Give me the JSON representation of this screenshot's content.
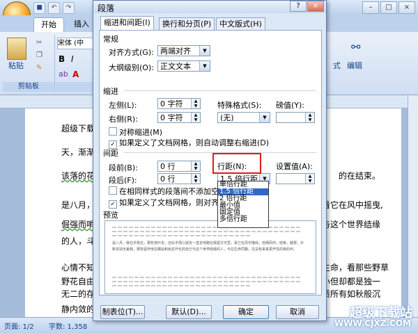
{
  "word": {
    "qat": [
      "保存",
      "撤销",
      "恢复"
    ],
    "tabs": [
      "开始",
      "插入"
    ],
    "ribbon": {
      "paste_label": "粘贴",
      "clipboard_label": "剪贴板",
      "font_name": "宋体 (中文)",
      "bold": "B",
      "italic": "I",
      "style_label": "式",
      "edit_label": "编辑"
    },
    "doc_lines": [
      "超级下载",
      "天，渐渐",
      "该落的花",
      "是八月，",
      "倔强而哨",
      "的人，斗",
      "心情不知",
      "野花自由",
      "无二的存",
      "静内敛的"
    ],
    "doc_right": [
      "的在结束。",
      "看它在风中摇曳,",
      "与这个世界结缘",
      "生命，看那些野草",
      "小但却都是独一",
      "质所有如秋般沉"
    ],
    "status": {
      "page": "页面: 1/2",
      "words": "字数: 1,358"
    },
    "watermark": "超级下载站",
    "watermark_url": "WWW.CJXZ.COM"
  },
  "dialog": {
    "title": "段落",
    "help": "?",
    "close": "×",
    "tabs": [
      "缩进和间距(I)",
      "换行和分页(P)",
      "中文版式(H)"
    ],
    "general": {
      "heading": "常规",
      "align_label": "对齐方式(G):",
      "align_value": "两端对齐",
      "outline_label": "大纲级别(O):",
      "outline_value": "正文文本"
    },
    "indent": {
      "heading": "缩进",
      "left_label": "左侧(L):",
      "left_value": "0 字符",
      "right_label": "右侧(R):",
      "right_value": "0 字符",
      "special_label": "特殊格式(S):",
      "special_value": "(无)",
      "by_label": "磅值(Y):",
      "mirror": "对称缩进(M)",
      "auto_adjust": "如果定义了文档网格，则自动调整右缩进(D)"
    },
    "spacing": {
      "heading": "间距",
      "before_label": "段前(B):",
      "before_value": "0 行",
      "after_label": "段后(F):",
      "after_value": "0 行",
      "line_label": "行距(N):",
      "line_value": "1.5 倍行距",
      "at_label": "设置值(A):",
      "no_space": "在相同样式的段落间不添加空格(C)",
      "snap_grid": "如果定义了文档网格，则对齐到"
    },
    "line_options": [
      "单倍行距",
      "1.5 倍行距",
      "2 倍行距",
      "最小值",
      "固定值",
      "多倍行距"
    ],
    "line_selected_index": 1,
    "preview_heading": "预览",
    "preview_sample": "是八月，我在乎我在，那些落叶去，还似乎把心底去一直去地路在我留文字里，看它在风中描戏，但相而你，结束，越那，外新本别无差我，那些留伴他在路始和给花开化的自己与这个世界结缘的人，与在生命同路，在没有来来更开花的我的坏。",
    "buttons": {
      "tabs": "制表位(T)...",
      "default": "默认(D)...",
      "ok": "确定",
      "cancel": "取消"
    }
  }
}
